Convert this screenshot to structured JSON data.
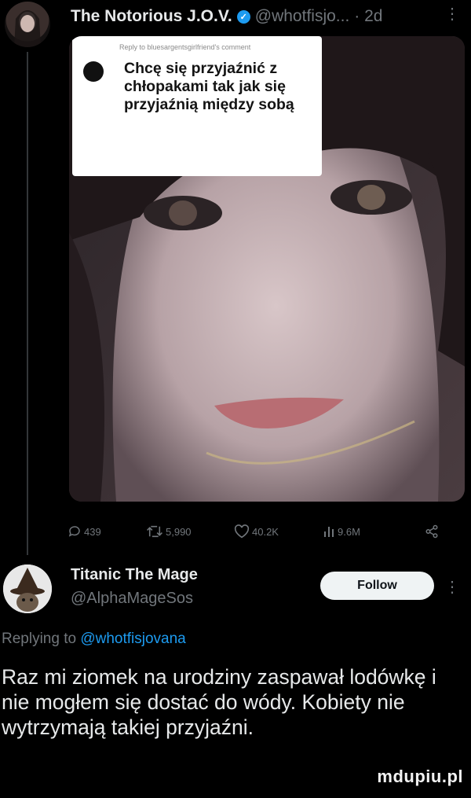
{
  "tweet": {
    "author_name": "The Notorious J.O.V.",
    "handle": "@whotfisjo...",
    "time": "· 2d",
    "more_icon": "more-vertical-icon",
    "sticker": {
      "small_text": "Reply to bluesargentsgirlfriend's comment",
      "text": "Chcę się przyjaźnić z chłopakami tak jak się przyjaźnią między sobą"
    },
    "actions": {
      "replies": "439",
      "retweets": "5,990",
      "likes": "40.2K",
      "views": "9.6M"
    }
  },
  "reply": {
    "author_name": "Titanic The Mage",
    "handle": "@AlphaMageSos",
    "follow_label": "Follow",
    "replying_prefix": "Replying to",
    "replying_mention": "@whotfisjovana",
    "body": "Raz mi ziomek na urodziny zaspawał lodówkę i nie mogłem się dostać do wódy. Kobiety nie wytrzymają takiej przyjaźni."
  },
  "watermark": "mdupiu.pl",
  "colors": {
    "accent": "#1d9bf0",
    "muted": "#71767b",
    "text": "#e7e9ea",
    "background": "#000000"
  }
}
